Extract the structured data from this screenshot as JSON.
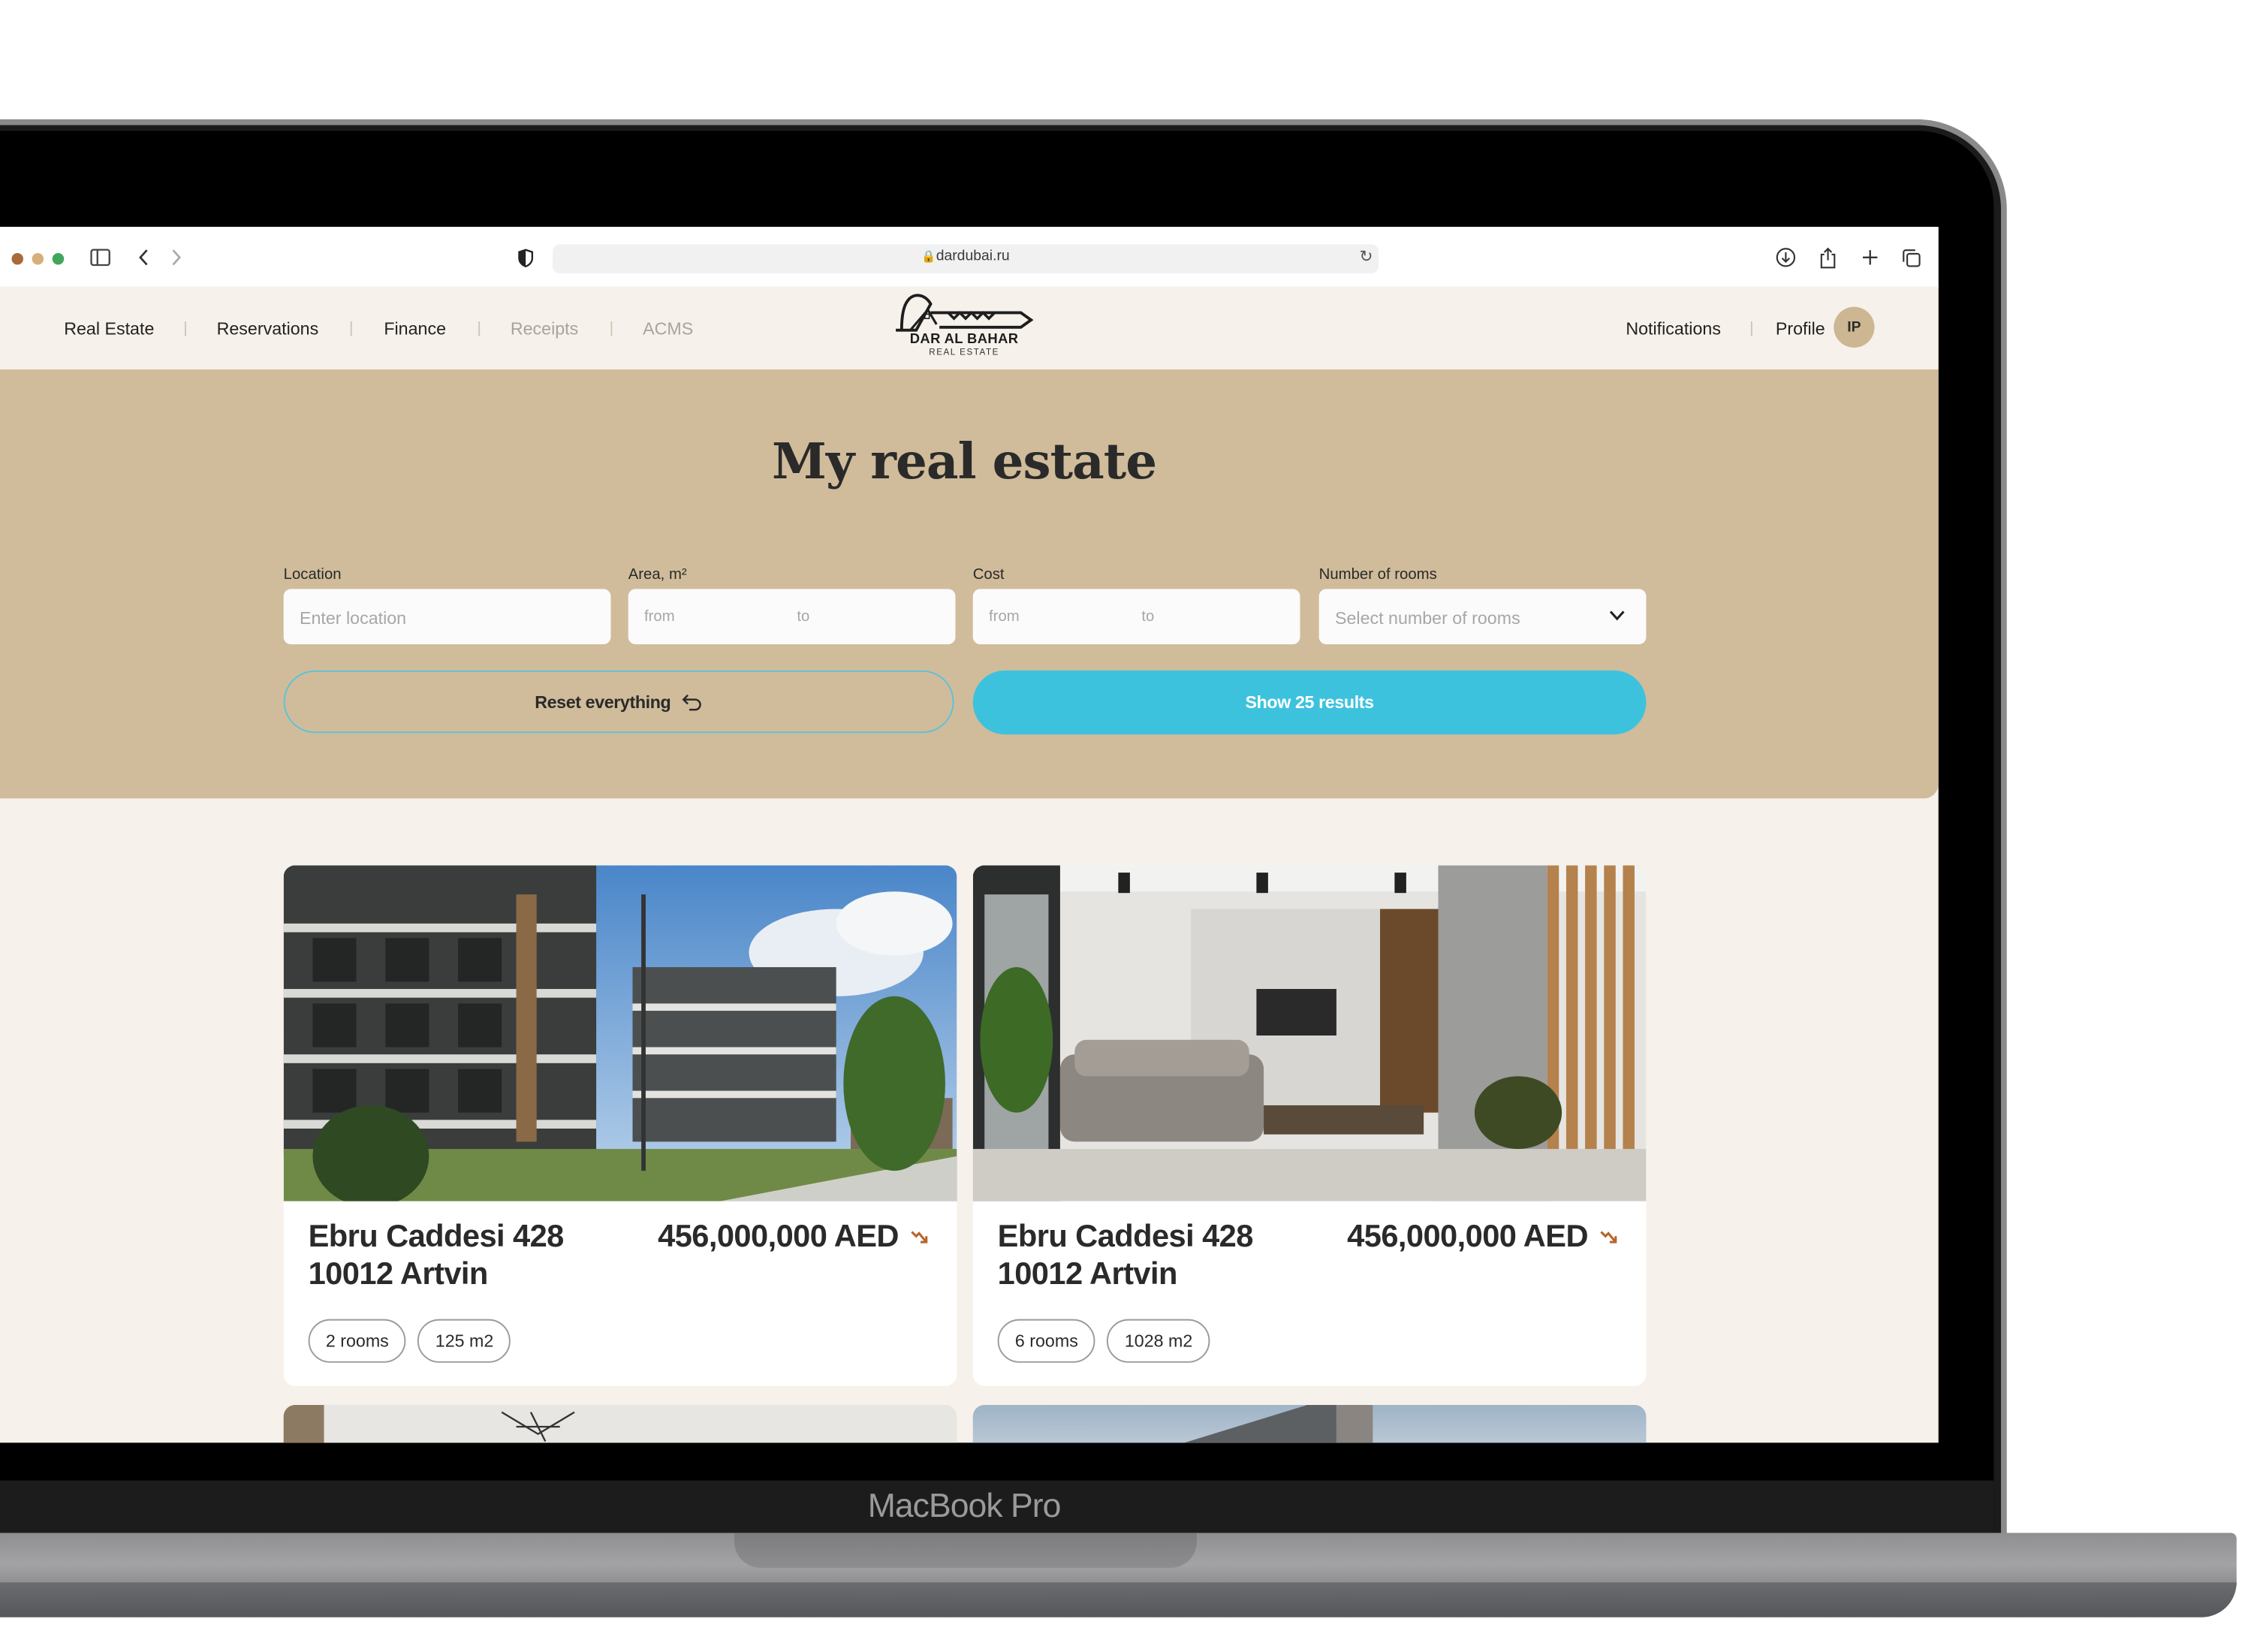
{
  "device": {
    "model_label": "MacBook Pro"
  },
  "browser": {
    "url": "dardubai.ru",
    "window_controls": [
      "close",
      "minimize",
      "zoom"
    ],
    "colors": {
      "close": "#a86a3a",
      "minimize": "#d6b07a",
      "zoom": "#3fa65a"
    },
    "left_icons": [
      "sidebar-icon",
      "back-icon",
      "forward-icon"
    ],
    "privacy_icon": "shield-icon",
    "reload_icon": "reload-icon",
    "right_icons": [
      "download-icon",
      "share-icon",
      "new-tab-icon",
      "tabs-overview-icon"
    ]
  },
  "nav": {
    "left_items": [
      {
        "label": "Real Estate",
        "enabled": true
      },
      {
        "label": "Reservations",
        "enabled": true
      },
      {
        "label": "Finance",
        "enabled": true
      },
      {
        "label": "Receipts",
        "enabled": false
      },
      {
        "label": "ACMS",
        "enabled": false
      }
    ],
    "logo": {
      "title": "DAR AL BAHAR",
      "subtitle": "REAL ESTATE"
    },
    "right_items": [
      {
        "label": "Notifications"
      },
      {
        "label": "Profile"
      }
    ],
    "avatar_initials": "IP"
  },
  "hero": {
    "title": "My real estate",
    "filters": {
      "location": {
        "label": "Location",
        "placeholder": "Enter location"
      },
      "area": {
        "label": "Area, m²",
        "from_placeholder": "from",
        "to_placeholder": "to"
      },
      "cost": {
        "label": "Cost",
        "from_placeholder": "from",
        "to_placeholder": "to"
      },
      "rooms": {
        "label": "Number of rooms",
        "placeholder": "Select number of rooms"
      }
    },
    "reset_label": "Reset everything",
    "show_label": "Show 25 results",
    "results_count": 25
  },
  "listings": [
    {
      "address": "Ebru Caddesi 428\n10012 Artvin",
      "price": "456,000,000 AED",
      "trend": "down",
      "rooms": "2 rooms",
      "area": "125 m2",
      "image": "modern apartment buildings exterior"
    },
    {
      "address": "Ebru Caddesi 428\n10012 Artvin",
      "price": "456,000,000 AED",
      "trend": "down",
      "rooms": "6 rooms",
      "area": "1028 m2",
      "image": "modern living room interior"
    }
  ],
  "theme": {
    "page_bg": "#f6f1ea",
    "hero_bg": "#d0bc9b",
    "accent": "#3dc2de",
    "trend_color": "#b8652a"
  }
}
